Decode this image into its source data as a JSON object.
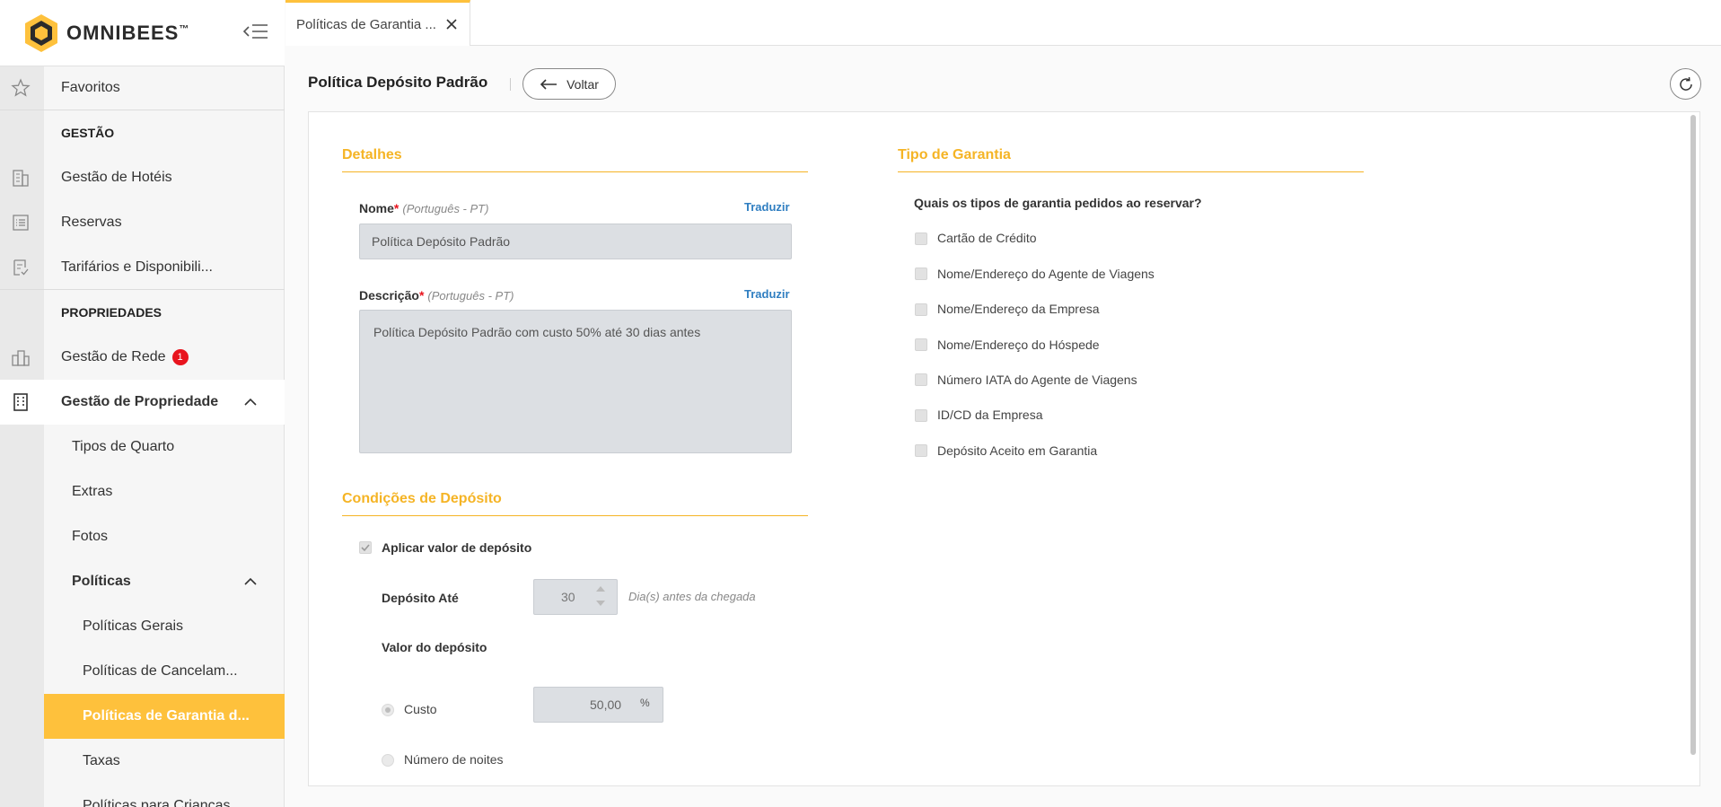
{
  "brand": {
    "name": "OMNIBEES",
    "trademark": "™",
    "accent": "#fec13c",
    "section_color": "#f5b425"
  },
  "sidebar": {
    "favorites": "Favoritos",
    "section_gestao": "GESTÃO",
    "hotels": "Gestão de Hotéis",
    "reservations": "Reservas",
    "rates": "Tarifários e Disponibili...",
    "section_propriedades": "PROPRIEDADES",
    "network": "Gestão de Rede",
    "network_badge": "1",
    "property": "Gestão de Propriedade",
    "room_types": "Tipos de Quarto",
    "extras": "Extras",
    "photos": "Fotos",
    "policies": "Políticas",
    "general_policies": "Políticas Gerais",
    "cancel_policies": "Políticas de Cancelam...",
    "guarantee_policies": "Políticas de Garantia d...",
    "taxes": "Taxas",
    "children_policies": "Políticas para Crianças"
  },
  "tab": {
    "label": "Políticas de Garantia ..."
  },
  "header": {
    "title": "Política Depósito Padrão",
    "back_label": "Voltar"
  },
  "details": {
    "title": "Detalhes",
    "name_label": "Nome",
    "required_mark": "*",
    "lang": "(Português - PT)",
    "translate": "Traduzir",
    "name_value": "Política Depósito Padrão",
    "desc_label": "Descrição",
    "desc_value": "Política Depósito Padrão com custo 50% até 30 dias antes"
  },
  "deposit": {
    "title": "Condições de Depósito",
    "apply_label": "Aplicar valor de depósito",
    "apply_checked": true,
    "until_label": "Depósito Até",
    "until_value": "30",
    "until_hint": "Dia(s) antes da chegada",
    "value_label": "Valor do depósito",
    "option_cost": "Custo",
    "cost_value": "50,00",
    "cost_unit": "%",
    "option_nights": "Número de noites",
    "selected_option": "Custo"
  },
  "guarantee": {
    "title": "Tipo de Garantia",
    "question": "Quais os tipos de garantia pedidos ao reservar?",
    "options": [
      "Cartão de Crédito",
      "Nome/Endereço do Agente de Viagens",
      "Nome/Endereço da Empresa",
      "Nome/Endereço do Hóspede",
      "Número IATA do Agente de Viagens",
      "ID/CD da Empresa",
      "Depósito Aceito em Garantia"
    ]
  },
  "icons": [
    "hexagon-logo-icon",
    "menu-collapse-icon",
    "star-icon",
    "building-icon",
    "list-icon",
    "document-check-icon",
    "city-icon",
    "property-icon",
    "chevron-up-icon",
    "close-icon",
    "arrow-left-icon",
    "refresh-icon",
    "spinner-up-icon",
    "spinner-down-icon",
    "checkmark-icon"
  ]
}
